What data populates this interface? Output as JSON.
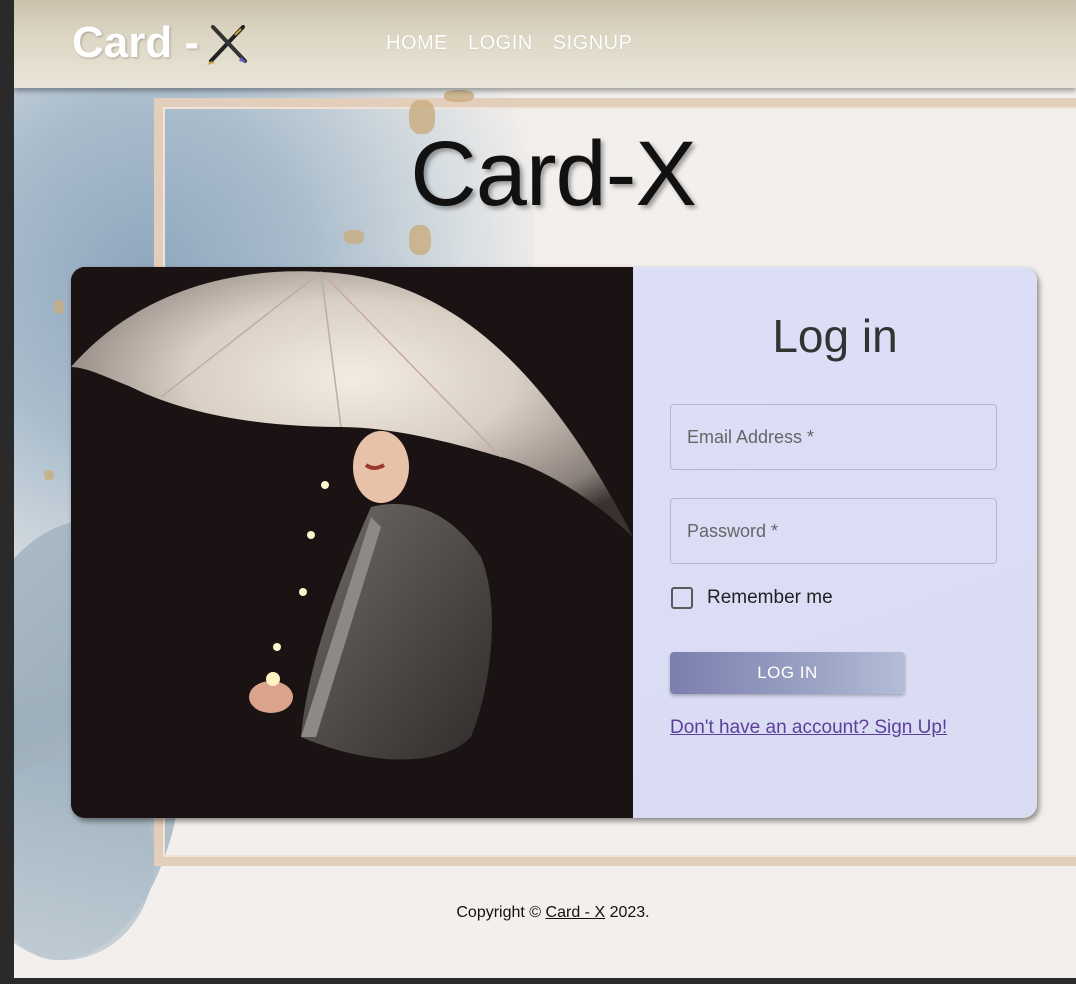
{
  "header": {
    "logo_text": "Card -",
    "logo_icon": "crossed-pens-icon",
    "nav": [
      {
        "label": "HOME"
      },
      {
        "label": "LOGIN"
      },
      {
        "label": "SIGNUP"
      }
    ]
  },
  "page_title": "Card-X",
  "login_form": {
    "title": "Log in",
    "email_placeholder": "Email Address *",
    "password_placeholder": "Password *",
    "remember_label": "Remember me",
    "remember_checked": false,
    "submit_label": "LOG IN",
    "signup_link": "Don't have an account? Sign Up!"
  },
  "footer": {
    "prefix": "Copyright ©",
    "link_text": "Card - X",
    "suffix": "2023."
  },
  "colors": {
    "form_panel": "#dcdef7",
    "button_start": "#7b7fae",
    "link": "#5c3f9c"
  }
}
